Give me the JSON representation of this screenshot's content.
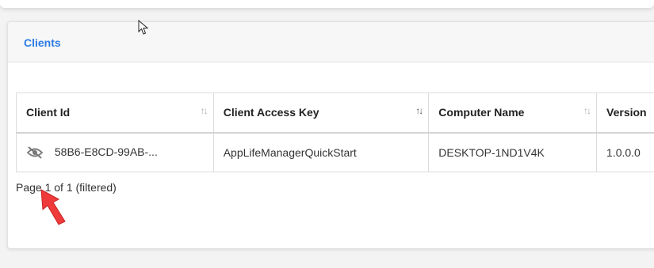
{
  "card": {
    "title": "Clients"
  },
  "table": {
    "columns": [
      {
        "label": "Client Id",
        "sort": "none"
      },
      {
        "label": "Client Access Key",
        "sort": "desc"
      },
      {
        "label": "Computer Name",
        "sort": "none"
      },
      {
        "label": "Version",
        "sort": "none"
      }
    ],
    "rows": [
      {
        "client_id": "58B6-E8CD-99AB-...",
        "access_key": "AppLifeManagerQuickStart",
        "computer_name": "DESKTOP-1ND1V4K",
        "version": "1.0.0.0"
      }
    ]
  },
  "pager": {
    "text": "Page 1 of 1 (filtered)"
  },
  "colors": {
    "accent": "#2c7be5",
    "arrow": "#ee3a3a"
  },
  "icons": {
    "row_action": "eye-slash-icon",
    "sort": "sort-arrows-icon"
  }
}
